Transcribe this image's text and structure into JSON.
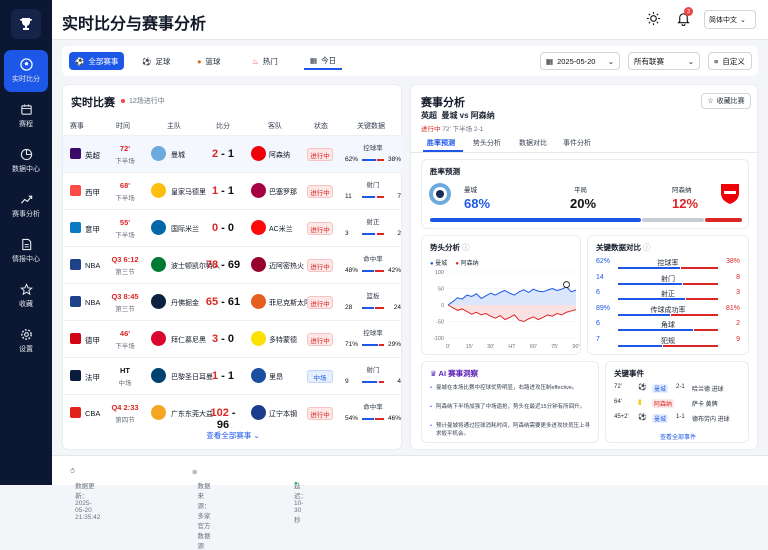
{
  "app": {
    "title": "实时比分与赛事分析",
    "language": "简体中文",
    "notif_count": "3"
  },
  "sidebar": {
    "items": [
      {
        "label": "实时比分",
        "icon": "soccer-ball-icon",
        "active": true
      },
      {
        "label": "赛程",
        "icon": "calendar-icon"
      },
      {
        "label": "数据中心",
        "icon": "pie-chart-icon"
      },
      {
        "label": "赛事分析",
        "icon": "trend-icon"
      },
      {
        "label": "情报中心",
        "icon": "document-icon"
      },
      {
        "label": "收藏",
        "icon": "star-icon"
      },
      {
        "label": "设置",
        "icon": "gear-icon"
      }
    ]
  },
  "filters": {
    "tabs": [
      {
        "label": "全部赛事",
        "active": true
      },
      {
        "label": "足球"
      },
      {
        "label": "篮球"
      },
      {
        "label": "热门"
      },
      {
        "label": "今日"
      }
    ],
    "date": "2025-05-20",
    "league": "所有联赛",
    "custom": "自定义"
  },
  "live": {
    "title": "实时比赛",
    "subtitle": "12场进行中",
    "headers": [
      "赛事",
      "时间",
      "主队",
      "比分",
      "客队",
      "状态",
      "关键数据"
    ],
    "rows": [
      {
        "league": "英超",
        "time": "72'",
        "period": "下半场",
        "home": "曼城",
        "hs": "2",
        "as": "1",
        "away": "阿森纳",
        "status": "进行中",
        "stat": "控球率",
        "l": "62%",
        "r": "38%",
        "frac": 0.62,
        "lc": "#3b0a6b",
        "hc": "#6cabdd",
        "ac": "#ef0107",
        "sel": true
      },
      {
        "league": "西甲",
        "time": "68'",
        "period": "下半场",
        "home": "皇家马德里",
        "hs": "1",
        "as": "1",
        "away": "巴塞罗那",
        "status": "进行中",
        "stat": "射门",
        "l": "11",
        "r": "7",
        "frac": 0.61,
        "lc": "#ff4b44",
        "hc": "#febe10",
        "ac": "#a50044"
      },
      {
        "league": "意甲",
        "time": "55'",
        "period": "下半场",
        "home": "国际米兰",
        "hs": "0",
        "as": "0",
        "away": "AC米兰",
        "status": "进行中",
        "stat": "射正",
        "l": "3",
        "r": "2",
        "frac": 0.6,
        "lc": "#0a7bc2",
        "hc": "#0068a8",
        "ac": "#fb090b"
      },
      {
        "league": "NBA",
        "time": "Q3 6:12",
        "period": "第三节",
        "home": "波士顿凯尔特人",
        "hs": "78",
        "as": "69",
        "away": "迈阿密热火",
        "status": "进行中",
        "stat": "命中率",
        "l": "48%",
        "r": "42%",
        "frac": 0.53,
        "lc": "#1d428a",
        "hc": "#007a33",
        "ac": "#98002e"
      },
      {
        "league": "NBA",
        "time": "Q3 8:45",
        "period": "第三节",
        "home": "丹佛掘金",
        "hs": "65",
        "as": "61",
        "away": "菲尼克斯太阳",
        "status": "进行中",
        "stat": "篮板",
        "l": "28",
        "r": "24",
        "frac": 0.54,
        "lc": "#1d428a",
        "hc": "#0e2240",
        "ac": "#e56020"
      },
      {
        "league": "德甲",
        "time": "46'",
        "period": "下半场",
        "home": "拜仁慕尼黑",
        "hs": "3",
        "as": "0",
        "away": "多特蒙德",
        "status": "进行中",
        "stat": "控球率",
        "l": "71%",
        "r": "29%",
        "frac": 0.71,
        "lc": "#d20515",
        "hc": "#dc052d",
        "ac": "#fde100"
      },
      {
        "league": "法甲",
        "time": "HT",
        "period": "中场",
        "home": "巴黎圣日耳曼",
        "hs": "1",
        "as": "1",
        "away": "里昂",
        "status": "中场",
        "stat": "射门",
        "l": "9",
        "r": "4",
        "frac": 0.69,
        "lc": "#091c3e",
        "hc": "#004170",
        "ac": "#1a4fa0",
        "ht": true
      },
      {
        "league": "CBA",
        "time": "Q4 2:33",
        "period": "第四节",
        "home": "广东东莞大益",
        "hs": "102",
        "as": "96",
        "away": "辽宁本钢",
        "status": "进行中",
        "stat": "命中率",
        "l": "54%",
        "r": "46%",
        "frac": 0.54,
        "lc": "#e2231a",
        "hc": "#f5a623",
        "ac": "#1a3c8f"
      }
    ],
    "more": "查看全部赛事"
  },
  "analysis": {
    "title": "赛事分析",
    "fav": "收藏比赛",
    "league": "英超",
    "matchup": "曼城 vs 阿森纳",
    "status": "进行中",
    "time": "72' 下半场 2-1",
    "tabs": [
      "胜率预测",
      "势头分析",
      "数据对比",
      "事件分析"
    ],
    "pred": {
      "title": "胜率预测",
      "home": "曼城",
      "draw": "平局",
      "away": "阿森纳",
      "hp": "68%",
      "dp": "20%",
      "ap": "12%",
      "hv": 68,
      "dv": 20,
      "av": 12
    },
    "momentum": {
      "title": "势头分析",
      "home": "曼城",
      "away": "阿森纳",
      "yticks": [
        "100",
        "50",
        "0",
        "-50",
        "-100"
      ],
      "xticks": [
        "0'",
        "15'",
        "30'",
        "HT",
        "60'",
        "75'",
        "90'"
      ]
    },
    "kd": {
      "title": "关键数据对比",
      "rows": [
        {
          "label": "控球率",
          "l": "62%",
          "r": "38%",
          "lv": 62,
          "rv": 38
        },
        {
          "label": "射门",
          "l": "14",
          "r": "8",
          "lv": 14,
          "rv": 8
        },
        {
          "label": "射正",
          "l": "6",
          "r": "3",
          "lv": 6,
          "rv": 3
        },
        {
          "label": "传球成功率",
          "l": "89%",
          "r": "81%",
          "lv": 89,
          "rv": 81
        },
        {
          "label": "角球",
          "l": "6",
          "r": "2",
          "lv": 6,
          "rv": 2
        },
        {
          "label": "犯规",
          "l": "7",
          "r": "9",
          "lv": 7,
          "rv": 9
        }
      ]
    },
    "ai": {
      "title": "AI 赛事洞察",
      "items": [
        "曼城在本场比赛中控球优势明显，右路进攻压制effective。",
        "阿森纳下半场加强了中场逼抢，势头在最近15分钟有所回升。",
        "预计曼城将通过控球消耗时间，阿森纳需要更多进攻扶员压上寻求扳平机会。"
      ]
    },
    "events": {
      "title": "关键事件",
      "rows": [
        {
          "min": "72'",
          "team": "曼城",
          "score": "2-1",
          "desc": "哈兰德 进球"
        },
        {
          "min": "64'",
          "team": "阿森纳",
          "score": "",
          "desc": "萨卡 黄牌"
        },
        {
          "min": "45+2'",
          "team": "曼城",
          "score": "1-1",
          "desc": "德布劳内 进球"
        }
      ],
      "more": "查看全部事件"
    }
  },
  "footer": {
    "update": "数据更新：2025-05-20 21:35:42",
    "source": "数据来源：多家官方数据源",
    "latency": "延迟：10-30秒"
  }
}
